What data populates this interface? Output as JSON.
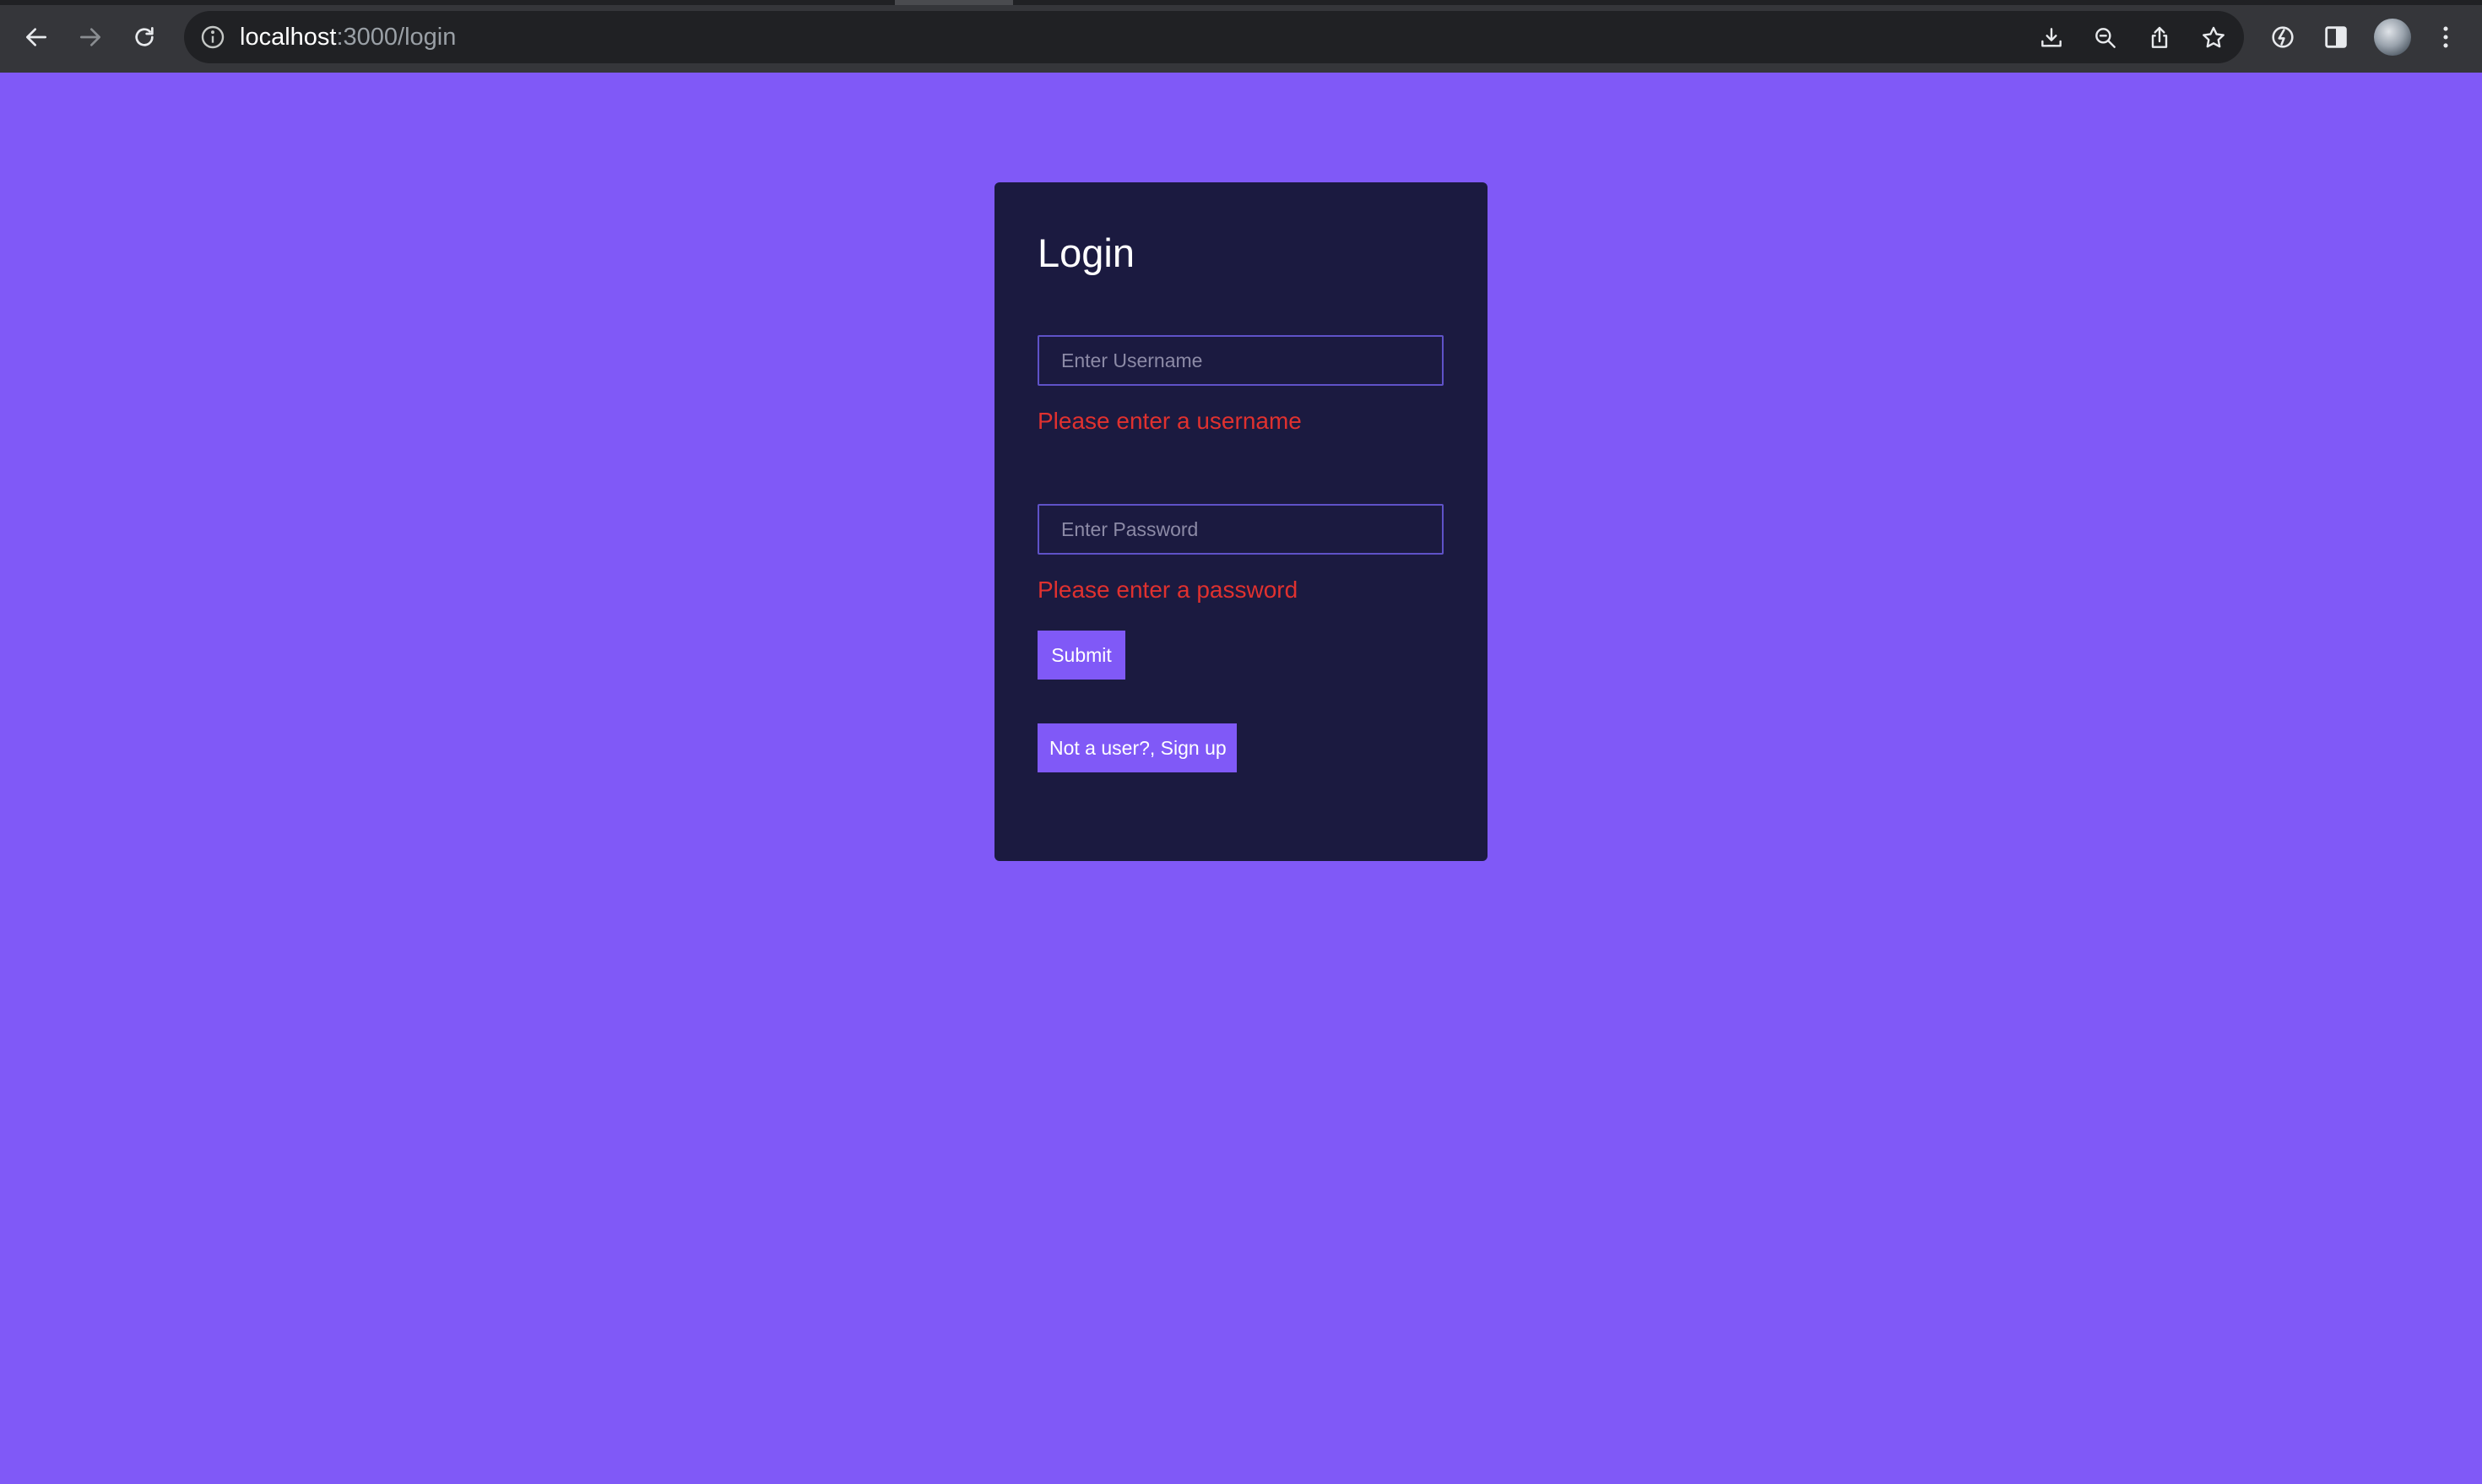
{
  "browser": {
    "url_host": "localhost",
    "url_path": ":3000/login",
    "icons": {
      "back": "arrow-left-icon",
      "forward": "arrow-right-icon",
      "reload": "reload-icon",
      "info": "info-icon",
      "install": "install-app-icon",
      "zoom": "zoom-icon",
      "share": "share-icon",
      "bookmark": "star-icon",
      "extensions": "extension-icon",
      "side_panel": "side-panel-icon",
      "menu": "kebab-menu-icon"
    }
  },
  "login": {
    "title": "Login",
    "username_placeholder": "Enter Username",
    "username_value": "",
    "username_error": "Please enter a username",
    "password_placeholder": "Enter Password",
    "password_value": "",
    "password_error": "Please enter a password",
    "submit_label": "Submit",
    "signup_label": "Not a user?, Sign up"
  },
  "colors": {
    "page_background": "#8059f7",
    "card_background": "#1b1a40",
    "accent": "#8059f7",
    "error": "#e0312f",
    "input_border": "#5f52c8"
  }
}
